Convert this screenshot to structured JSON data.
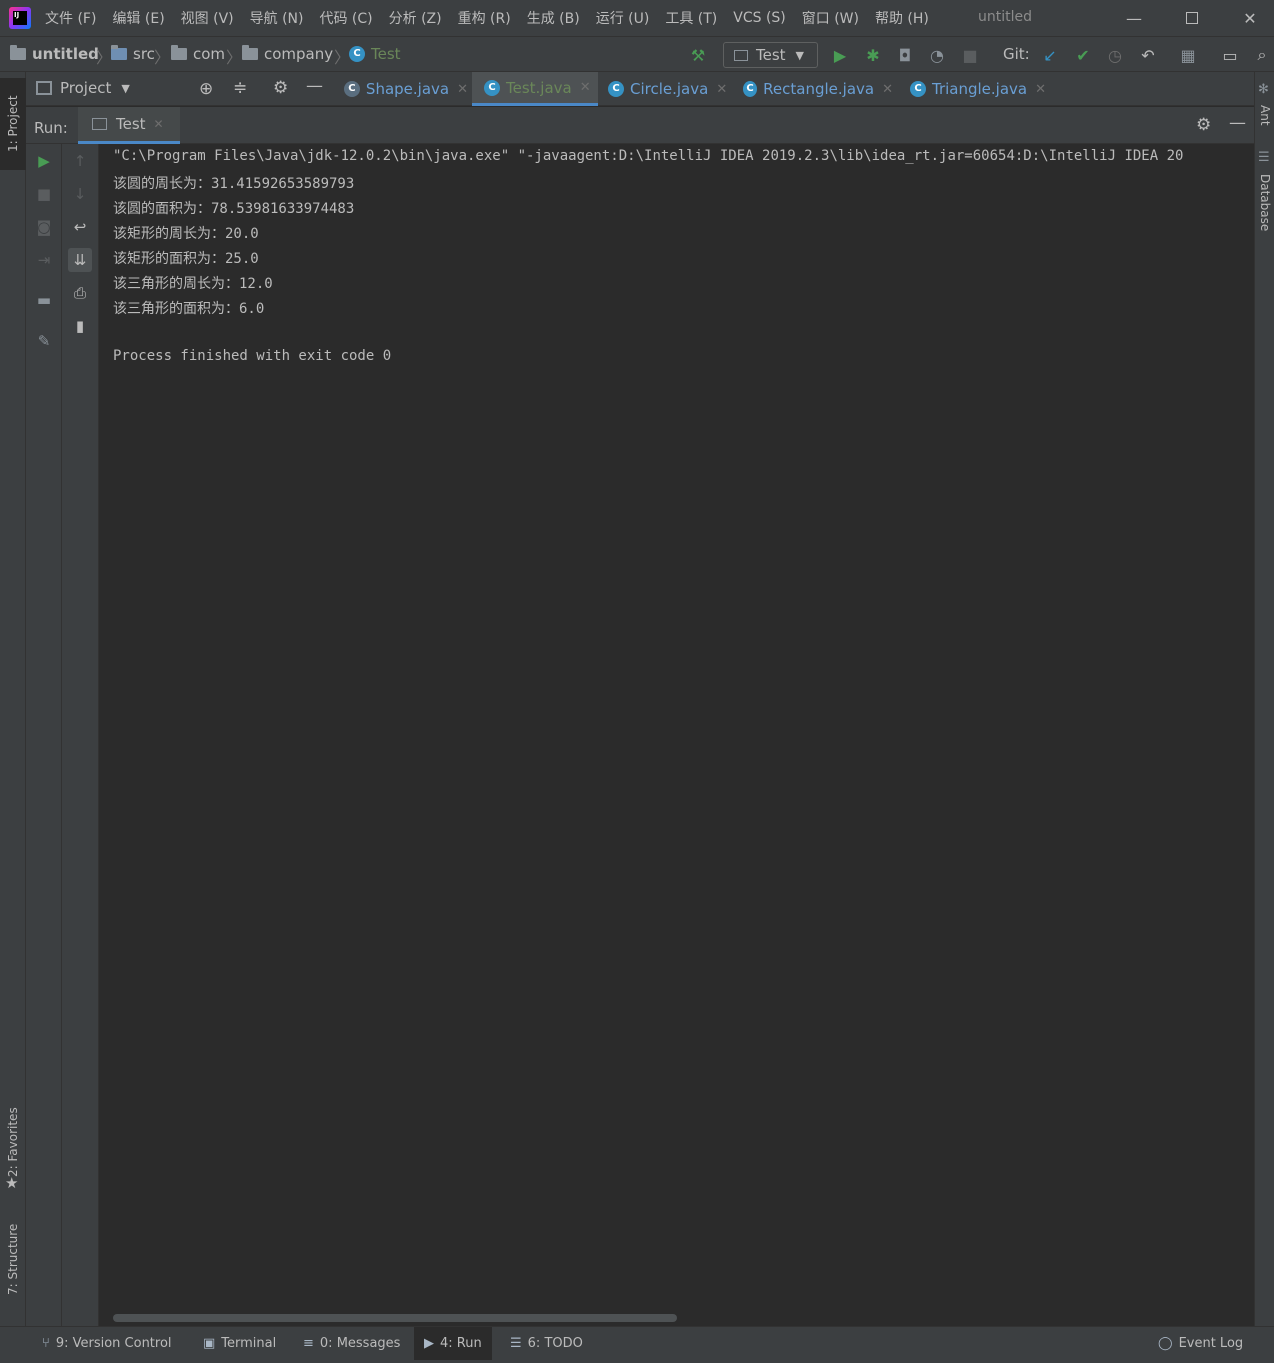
{
  "menu": [
    "文件 (F)",
    "编辑 (E)",
    "视图 (V)",
    "导航 (N)",
    "代码 (C)",
    "分析 (Z)",
    "重构 (R)",
    "生成 (B)",
    "运行 (U)",
    "工具 (T)",
    "VCS (S)",
    "窗口 (W)",
    "帮助 (H)"
  ],
  "window_title": "untitled",
  "breadcrumb": {
    "project": "untitled",
    "src": "src",
    "com": "com",
    "company": "company",
    "class": "Test"
  },
  "run_config": "Test",
  "git_label": "Git:",
  "project_panel_label": "Project",
  "editor_tabs": [
    {
      "label": "Shape.java"
    },
    {
      "label": "Test.java"
    },
    {
      "label": "Circle.java"
    },
    {
      "label": "Rectangle.java"
    },
    {
      "label": "Triangle.java"
    }
  ],
  "side_tabs": {
    "project": "1: Project",
    "favorites": "2: Favorites",
    "structure": "7: Structure",
    "ant": "Ant",
    "database": "Database"
  },
  "run_panel": {
    "label": "Run:",
    "tab": "Test"
  },
  "console": [
    "\"C:\\Program Files\\Java\\jdk-12.0.2\\bin\\java.exe\" \"-javaagent:D:\\IntelliJ IDEA 2019.2.3\\lib\\idea_rt.jar=60654:D:\\IntelliJ IDEA 20",
    "该圆的周长为：31.41592653589793",
    "该圆的面积为：78.53981633974483",
    "该矩形的周长为：20.0",
    "该矩形的面积为：25.0",
    "该三角形的周长为：12.0",
    "该三角形的面积为：6.0",
    "",
    "Process finished with exit code 0"
  ],
  "bottom_bar": {
    "version_control": "9: Version Control",
    "terminal": "Terminal",
    "messages": "0: Messages",
    "run": "4: Run",
    "todo": "6: TODO",
    "event_log": "Event Log"
  },
  "colors": {
    "background": "#2b2b2b",
    "panel": "#3c3f41",
    "accent": "#4a88c7",
    "run_green": "#499c54",
    "class_blue": "#3592c4"
  }
}
